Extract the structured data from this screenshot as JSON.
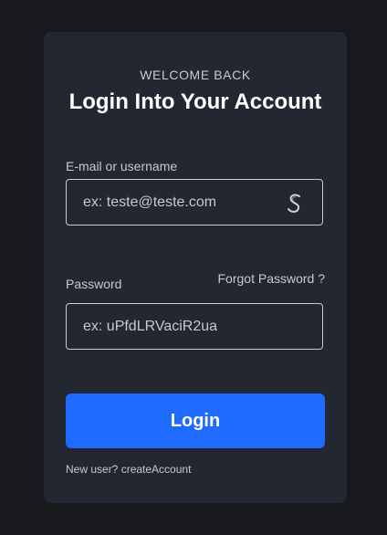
{
  "card": {
    "eyebrow": "WELCOME BACK",
    "title": "Login Into Your Account"
  },
  "email": {
    "label": "E-mail or username",
    "placeholder": "ex: teste@teste.com",
    "value": "",
    "icon": "lastpass-icon"
  },
  "password": {
    "label": "Password",
    "placeholder": "ex: uPfdLRVaciR2ua",
    "value": "",
    "forgot_label": "Forgot Password ?"
  },
  "login": {
    "label": "Login"
  },
  "footer": {
    "prefix": "New user?",
    "link_label": "createAccount"
  },
  "colors": {
    "page_background": "#18191c",
    "card_background": "#232731",
    "primary_button": "#1f6bff",
    "text_muted": "#c6c9d0",
    "text_strong": "#ffffff"
  }
}
